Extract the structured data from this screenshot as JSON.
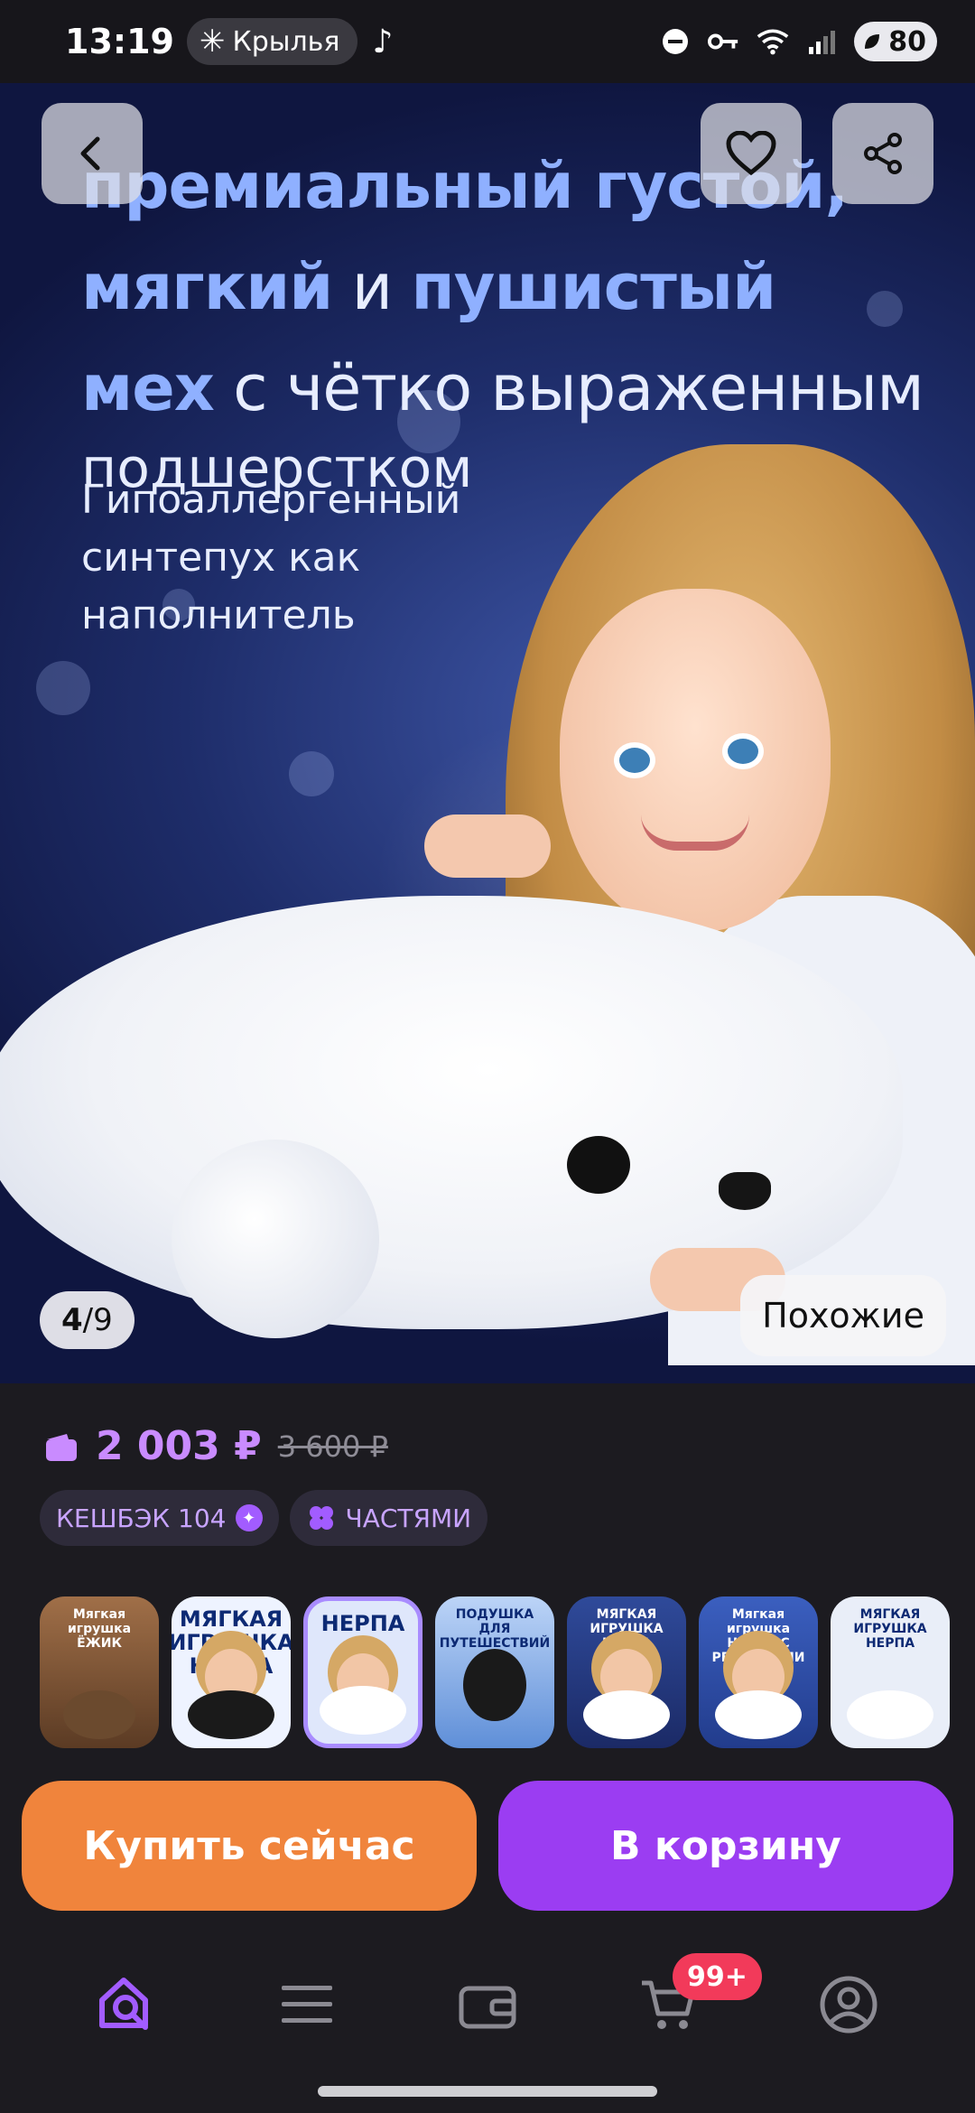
{
  "status_bar": {
    "time": "13:19",
    "chip_label": "Крылья",
    "battery": "80"
  },
  "hero": {
    "headline_1": "премиальный густой,",
    "headline_2_bold_a": "мягкий",
    "headline_2_thin": " и ",
    "headline_2_bold_b": "пушистый",
    "headline_3_bold": "мех",
    "headline_3_thin": " с чётко выраженным",
    "headline_4": "подшерстком",
    "note": "Гипоаллергенный синтепух как наполнитель",
    "counter_current": "4",
    "counter_total": "/9",
    "similar_label": "Похожие"
  },
  "price": {
    "current": "2 003 ₽",
    "old": "3 600 ₽"
  },
  "badges": {
    "cashback": "КЕШБЭК 104",
    "installments": "ЧАСТЯМИ"
  },
  "thumbnails": [
    {
      "title": "Мягкая игрушка ЁЖИК"
    },
    {
      "title": "МЯГКАЯ ИГРУШКА НЕРПА",
      "size": "35"
    },
    {
      "title": "НЕРПА",
      "size": "35",
      "selected": true
    },
    {
      "title": "ПОДУШКА ДЛЯ ПУТЕШЕСТВИЙ"
    },
    {
      "title": "МЯГКАЯ ИГРУШКА НЕРПА"
    },
    {
      "title": "Мягкая игрушка НЕРПА С РЕСНИЦАМИ",
      "size": "35"
    },
    {
      "title": "МЯГКАЯ ИГРУШКА НЕРПА",
      "size": "25"
    }
  ],
  "actions": {
    "buy_now": "Купить сейчас",
    "add_to_cart": "В корзину"
  },
  "nav": {
    "cart_badge": "99+"
  },
  "colors": {
    "accent_purple": "#9b3df2",
    "accent_orange": "#f0843c",
    "price_purple": "#c98bff"
  }
}
